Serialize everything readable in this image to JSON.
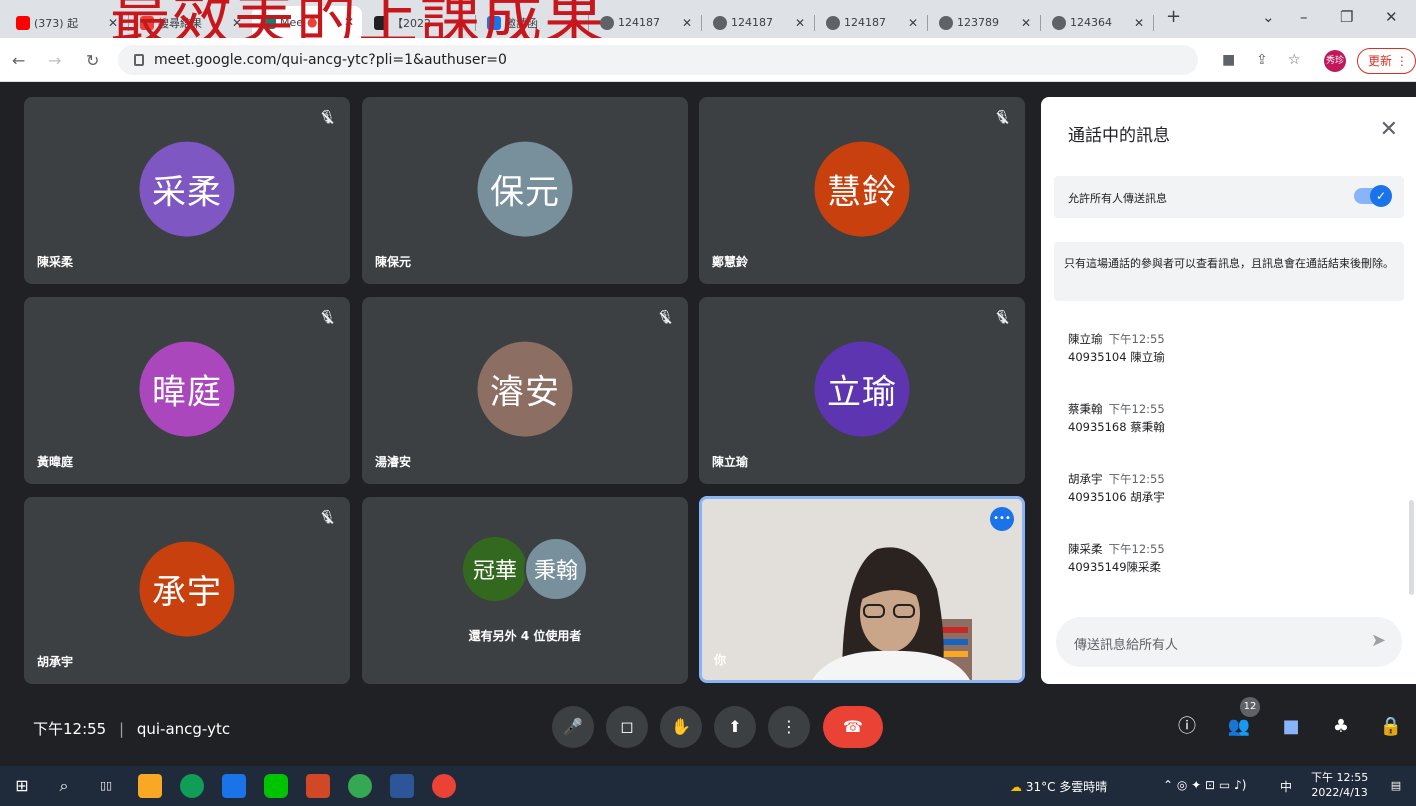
{
  "overlay_title": "最效美的上課成果",
  "browser": {
    "tabs": [
      {
        "label": "(373) 起",
        "color": "#ff0000"
      },
      {
        "label": "搜尋結果",
        "color": "#ea4335"
      },
      {
        "label": "Mee",
        "color": "#00897b"
      },
      {
        "label": "【2022",
        "color": "#202124"
      },
      {
        "label": "邀請函",
        "color": "#1a73e8"
      },
      {
        "label": "124187",
        "color": "#5f6368"
      },
      {
        "label": "124187",
        "color": "#5f6368"
      },
      {
        "label": "124187",
        "color": "#5f6368"
      },
      {
        "label": "123789",
        "color": "#5f6368"
      },
      {
        "label": "124364",
        "color": "#5f6368"
      }
    ],
    "new_tab": "+",
    "url": "meet.google.com/qui-ancg-ytc?pli=1&authuser=0",
    "profile_initial": "秀珍",
    "update_label": "更新"
  },
  "tiles": [
    {
      "initials": "采柔",
      "name": "陳采柔",
      "color": "#7e57c2"
    },
    {
      "initials": "保元",
      "name": "陳保元",
      "color": "#78909c"
    },
    {
      "initials": "慧鈴",
      "name": "鄭慧鈴",
      "color": "#c8400e"
    },
    {
      "initials": "暐庭",
      "name": "黃暐庭",
      "color": "#ab47bc"
    },
    {
      "initials": "濬安",
      "name": "湯濬安",
      "color": "#8d6e63"
    },
    {
      "initials": "立瑜",
      "name": "陳立瑜",
      "color": "#5e35b1"
    },
    {
      "initials": "承宇",
      "name": "胡承宇",
      "color": "#c8400e"
    }
  ],
  "others_tile": {
    "avatar1": "冠華",
    "avatar1_color": "#33691e",
    "avatar2": "秉翰",
    "avatar2_color": "#78909c",
    "label": "還有另外 4 位使用者"
  },
  "self_tile": {
    "name": "你"
  },
  "chat": {
    "title": "通話中的訊息",
    "allow_label": "允許所有人傳送訊息",
    "info": "只有這場通話的參與者可以查看訊息，且訊息會在通話結束後刪除。",
    "messages": [
      {
        "sender": "陳立瑜",
        "time": "下午12:55",
        "text": "40935104 陳立瑜"
      },
      {
        "sender": "蔡秉翰",
        "time": "下午12:55",
        "text": "40935168 蔡秉翰"
      },
      {
        "sender": "胡承宇",
        "time": "下午12:55",
        "text": "40935106 胡承宇"
      },
      {
        "sender": "陳采柔",
        "time": "下午12:55",
        "text": "40935149陳采柔"
      }
    ],
    "input_placeholder": "傳送訊息給所有人"
  },
  "meeting": {
    "time": "下午12:55",
    "separator": "|",
    "code": "qui-ancg-ytc",
    "participant_count": "12"
  },
  "taskbar": {
    "weather": "31°C 多雲時晴",
    "ime": "中",
    "clock_time": "下午 12:55",
    "clock_date": "2022/4/13"
  }
}
